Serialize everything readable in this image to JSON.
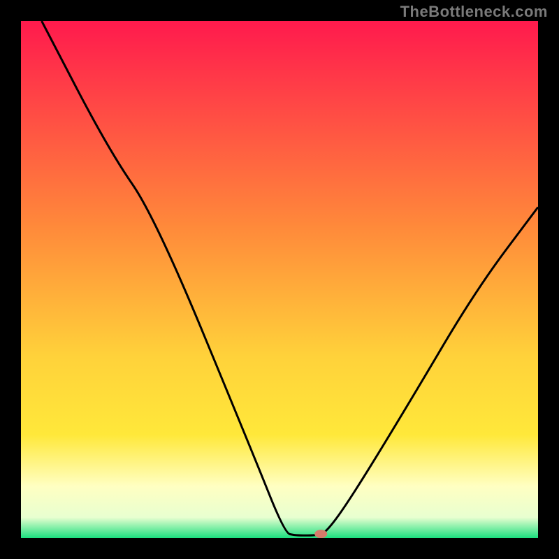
{
  "watermark": "TheBottleneck.com",
  "chart_data": {
    "type": "line",
    "title": "",
    "xlabel": "",
    "ylabel": "",
    "xlim": [
      0,
      100
    ],
    "ylim": [
      0,
      100
    ],
    "background_gradient": {
      "stops": [
        {
          "offset": 0,
          "color": "#ff1a4d"
        },
        {
          "offset": 40,
          "color": "#ff8a3a"
        },
        {
          "offset": 65,
          "color": "#ffd23a"
        },
        {
          "offset": 80,
          "color": "#ffe83a"
        },
        {
          "offset": 90,
          "color": "#ffffc2"
        },
        {
          "offset": 96,
          "color": "#e8ffd0"
        },
        {
          "offset": 100,
          "color": "#1bdf7f"
        }
      ]
    },
    "series": [
      {
        "name": "bottleneck-curve",
        "color": "#000000",
        "points": [
          {
            "x": 4,
            "y": 100
          },
          {
            "x": 17,
            "y": 75
          },
          {
            "x": 26,
            "y": 62
          },
          {
            "x": 45,
            "y": 16
          },
          {
            "x": 51,
            "y": 1
          },
          {
            "x": 53,
            "y": 0.5
          },
          {
            "x": 57,
            "y": 0.5
          },
          {
            "x": 59,
            "y": 1
          },
          {
            "x": 64,
            "y": 8
          },
          {
            "x": 75,
            "y": 26
          },
          {
            "x": 88,
            "y": 48
          },
          {
            "x": 100,
            "y": 64
          }
        ]
      }
    ],
    "marker": {
      "name": "optimal-point",
      "x": 58,
      "y": 0.8,
      "color": "#d77a6a"
    }
  }
}
